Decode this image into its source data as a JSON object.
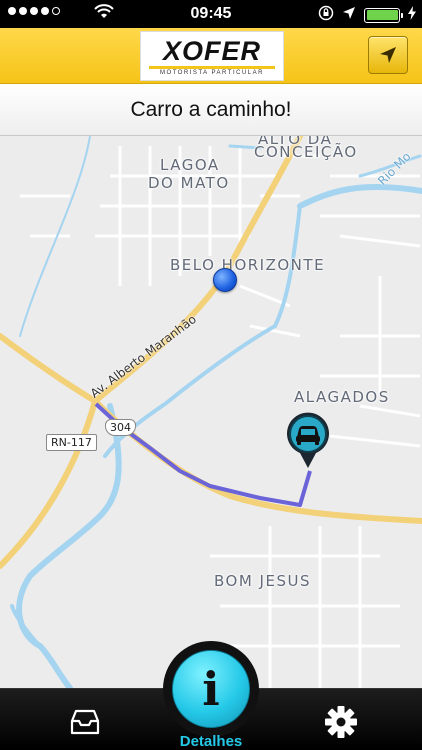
{
  "status_bar": {
    "time": "09:45",
    "signal_dots": [
      true,
      true,
      true,
      true,
      false
    ]
  },
  "header": {
    "logo_text": "XOFER",
    "logo_subtitle": "MOTORISTA PARTICULAR",
    "nav_icon": "location-arrow-icon"
  },
  "banner": {
    "message": "Carro a caminho!"
  },
  "map": {
    "places": {
      "alto": "ALTO DA",
      "conceicao": "CONCEIÇÃO",
      "lagoa": "LAGOA",
      "do_mato": "DO MATO",
      "belo_horizonte": "BELO HORIZONTE",
      "alagados": "ALAGADOS",
      "bom_jesus": "BOM JESUS"
    },
    "streets": {
      "av_alberto": "Av. Alberto Maranhão",
      "rio_mo": "Rio Mo"
    },
    "road_tags": {
      "rn117": "RN-117",
      "br304": "304"
    },
    "colors": {
      "route": "#6b63d8",
      "water": "#a4d4f0",
      "major_road": "#f7d774"
    }
  },
  "tab_bar": {
    "inbox_icon": "inbox-icon",
    "settings_icon": "gear-icon",
    "center_label": "Detalhes",
    "center_icon": "info-icon"
  }
}
